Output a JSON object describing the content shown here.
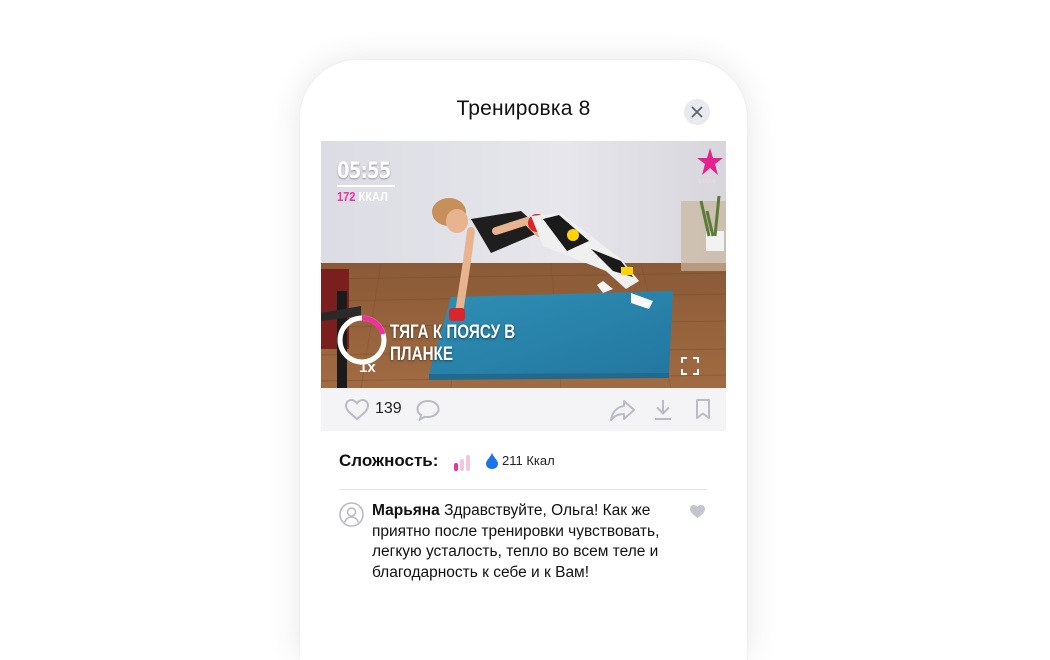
{
  "modal": {
    "title": "Тренировка 8"
  },
  "video": {
    "timer": "05:55",
    "kcal_value": "172",
    "kcal_unit": "ККАЛ",
    "brand_text": "STARS",
    "exercise_name": "ТЯГА К ПОЯСУ В ПЛАНКЕ",
    "speed": "1x"
  },
  "actions": {
    "likes_count": "139"
  },
  "details": {
    "difficulty_label": "Сложность:",
    "difficulty_level": 1,
    "difficulty_max": 3,
    "calories": "211 Ккал"
  },
  "comment": {
    "author": "Марьяна",
    "text": "Здравствуйте, Ольга! Как же приятно после тренировки чувствовать, легкую усталость, тепло во всем теле и благодарность к себе и к Вам!"
  },
  "colors": {
    "accent_pink": "#f12f9e",
    "drop_blue": "#1a73e8",
    "icon_gray": "#b9bcc6"
  }
}
